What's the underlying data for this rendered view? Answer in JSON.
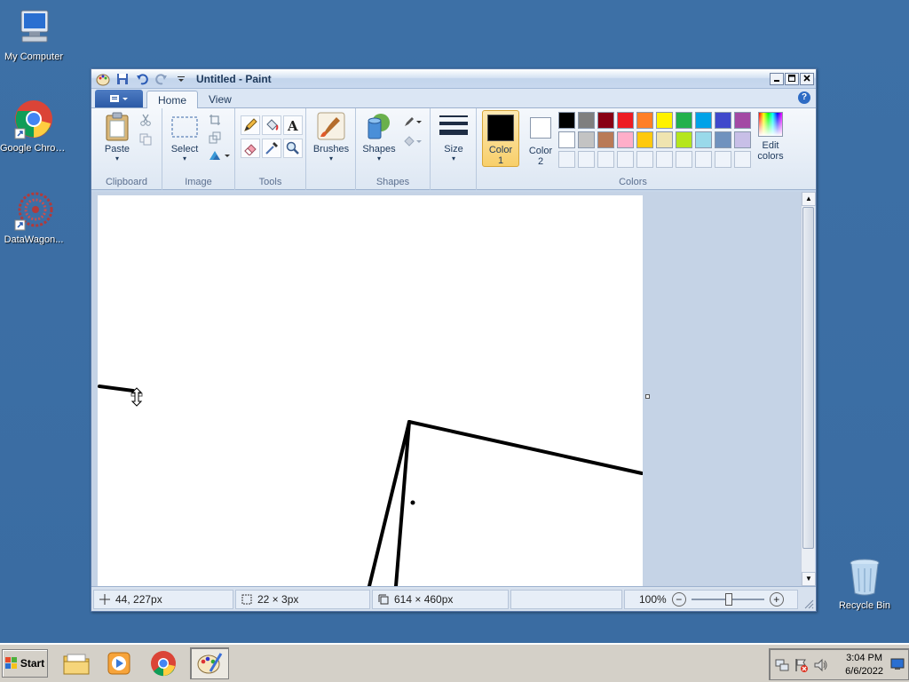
{
  "desktop": {
    "icons": [
      {
        "label": "My Computer",
        "icon": "computer-icon"
      },
      {
        "label": "Google Chrome",
        "icon": "chrome-icon"
      },
      {
        "label": "DataWagon...",
        "icon": "datawagon-icon"
      },
      {
        "label": "Recycle Bin",
        "icon": "recycle-bin-icon"
      }
    ]
  },
  "window": {
    "title": "Untitled - Paint",
    "tabs": [
      "Home",
      "View"
    ],
    "active_tab": "Home",
    "help_glyph": "?"
  },
  "ribbon": {
    "groups": {
      "clipboard": "Clipboard",
      "image": "Image",
      "tools": "Tools",
      "shapes": "Shapes",
      "colors": "Colors"
    },
    "buttons": {
      "paste": "Paste",
      "select": "Select",
      "brushes": "Brushes",
      "shapes": "Shapes",
      "size": "Size",
      "color1_line1": "Color",
      "color1_line2": "1",
      "color2_line1": "Color",
      "color2_line2": "2",
      "edit_colors_line1": "Edit",
      "edit_colors_line2": "colors"
    },
    "palette_row1": [
      "#000000",
      "#7f7f7f",
      "#880015",
      "#ed1c24",
      "#ff7f27",
      "#fff200",
      "#22b14c",
      "#00a2e8",
      "#3f48cc",
      "#a349a4"
    ],
    "palette_row2": [
      "#ffffff",
      "#c3c3c3",
      "#b97a57",
      "#ffaec9",
      "#ffc90e",
      "#efe4b0",
      "#b5e61d",
      "#99d9ea",
      "#7092be",
      "#c8bfe7"
    ],
    "color1": "#000000",
    "color2": "#ffffff"
  },
  "status": {
    "cursor_pos": "44, 227px",
    "selection_size": "22 × 3px",
    "image_size": "614 × 460px",
    "zoom": "100%"
  },
  "taskbar": {
    "start_label": "Start",
    "clock_time": "3:04 PM",
    "clock_date": "6/6/2022"
  }
}
